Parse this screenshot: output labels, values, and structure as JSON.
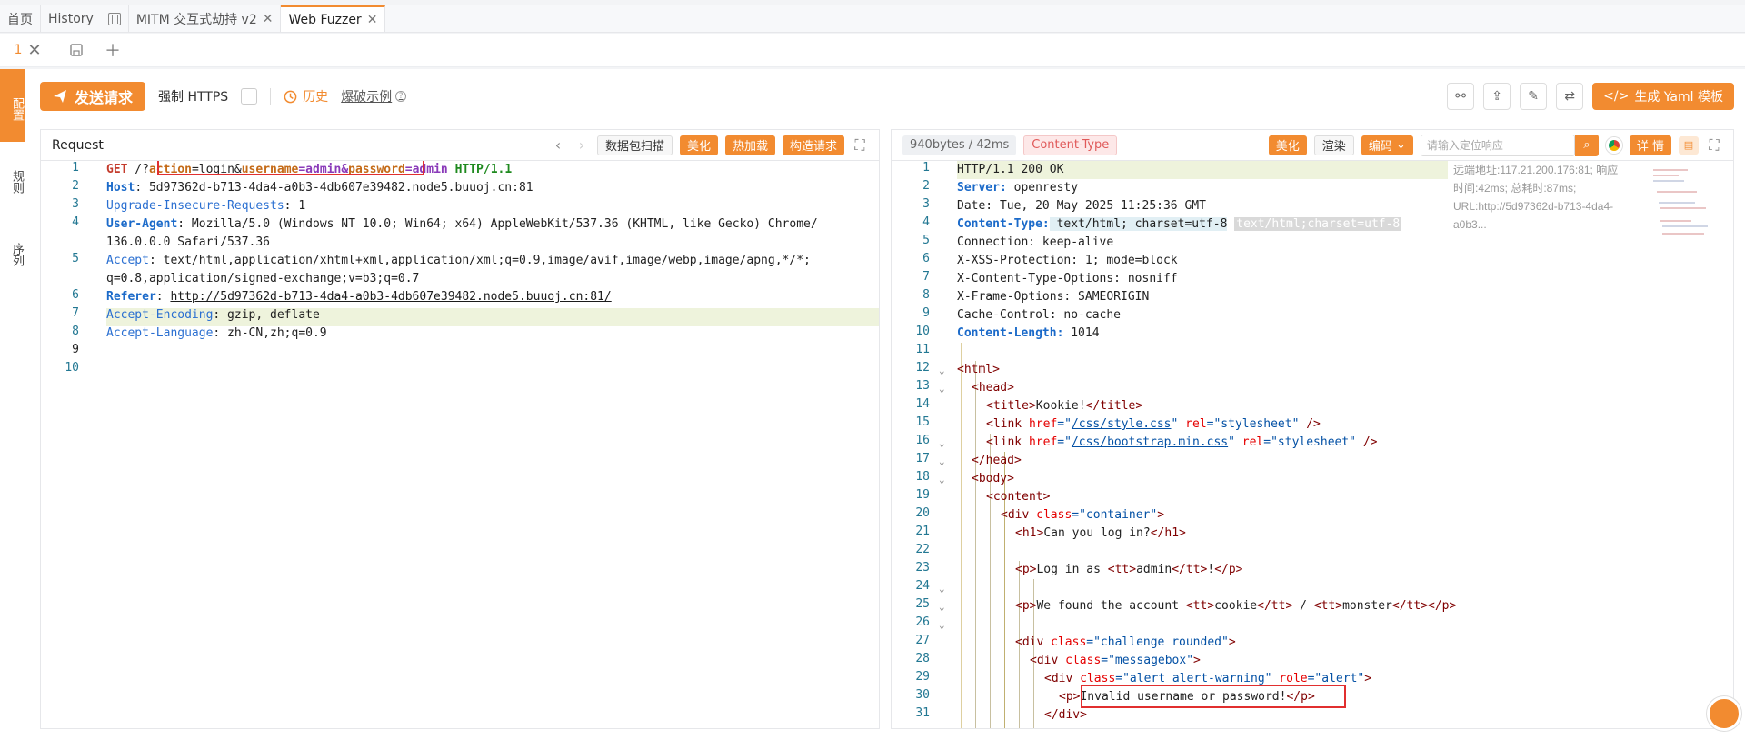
{
  "tabs": [
    {
      "label": "首页"
    },
    {
      "label": "History"
    },
    {
      "label": "MITM 交互式劫持 v2"
    },
    {
      "label": "Web Fuzzer"
    }
  ],
  "subbar": {
    "page_num": "1"
  },
  "leftstrip": [
    {
      "label": "配置"
    },
    {
      "label": "规则"
    },
    {
      "label": "序列"
    }
  ],
  "actions": {
    "send": "发送请求",
    "force_https": "强制 HTTPS",
    "history": "历史",
    "brute": "爆破示例",
    "yaml": "生成 Yaml 模板"
  },
  "request": {
    "title": "Request",
    "btn_scan": "数据包扫描",
    "btn_beautify": "美化",
    "btn_hotload": "热加载",
    "btn_build": "构造请求",
    "line_numbers": [
      "1",
      "2",
      "3",
      "4",
      "",
      "5",
      "",
      "6",
      "7",
      "8",
      "9",
      "10"
    ]
  },
  "response": {
    "size": "940bytes / 42ms",
    "ctype": "Content-Type",
    "btn_beautify": "美化",
    "btn_render": "渲染",
    "btn_encode": "编码",
    "search_placeholder": "请输入定位响应",
    "btn_detail": "详 情",
    "info": "远端地址:117.21.200.176:81; 响应时间:42ms; 总耗时:87ms; URL:http://5d97362d-b713-4da4-a0b3...",
    "line_numbers": [
      "1",
      "2",
      "3",
      "4",
      "5",
      "6",
      "7",
      "8",
      "9",
      "10",
      "11",
      "12",
      "13",
      "14",
      "15",
      "16",
      "17",
      "18",
      "19",
      "20",
      "21",
      "22",
      "23",
      "24",
      "25",
      "26",
      "27",
      "28",
      "29",
      "30",
      "31"
    ]
  },
  "req_lines": {
    "l1a": "GET",
    "l1b": " /?",
    "l1c": "action",
    "l1d": "=login&",
    "l1e": "username",
    "l1f": "=admin&",
    "l1g": "password",
    "l1h": "=admin",
    "l1i": " HTTP/1.1",
    "l2a": "Host",
    "l2b": ": 5d97362d-b713-4da4-a0b3-4db607e39482.node5.buuoj.cn:81",
    "l3a": "Upgrade-Insecure-Requests",
    "l3b": ": 1",
    "l4a": "User-Agent",
    "l4b": ": Mozilla/5.0 (Windows NT 10.0; Win64; x64) AppleWebKit/537.36 (KHTML, like Gecko) Chrome/",
    "l4c": "136.0.0.0 Safari/537.36",
    "l5a": "Accept",
    "l5b": ": text/html,application/xhtml+xml,application/xml;q=0.9,image/avif,image/webp,image/apng,*/*;",
    "l5c": "q=0.8,application/signed-exchange;v=b3;q=0.7",
    "l6a": "Referer",
    "l6b": ": ",
    "l6c": "http://5d97362d-b713-4da4-a0b3-4db607e39482.node5.buuoj.cn:81/",
    "l7a": "Accept-Encoding",
    "l7b": ": gzip, deflate",
    "l8a": "Accept-Language",
    "l8b": ": zh-CN,zh;q=0.9"
  },
  "resp_lines": {
    "r1": "HTTP/1.1 200 OK",
    "r2a": "Server:",
    "r2b": " openresty",
    "r3": "Date: Tue, 20 May 2025 11:25:36 GMT",
    "r4a": "Content-Type:",
    "r4b": " text/html; charset=utf-8",
    "r4c": "text/html;charset=utf-8",
    "r5": "Connection: keep-alive",
    "r6": "X-XSS-Protection: 1; mode=block",
    "r7": "X-Content-Type-Options: nosniff",
    "r8": "X-Frame-Options: SAMEORIGIN",
    "r9": "Cache-Control: no-cache",
    "r10a": "Content-Length:",
    "r10b": " 1014",
    "r12": "<html>",
    "r13": "<head>",
    "r14a": "<title>",
    "r14b": "Kookie!",
    "r14c": "</title>",
    "r15a": "<link ",
    "r15b": "href",
    "r15c": "=\"",
    "r15d": "/css/style.css",
    "r15e": "\" ",
    "r15f": "rel",
    "r15g": "=\"stylesheet\"",
    "r15h": " />",
    "r16d": "/css/bootstrap.min.css",
    "r17": "</head>",
    "r18": "<body>",
    "r19": "<content>",
    "r20a": "<div ",
    "r20b": "class",
    "r20c": "=\"container\"",
    "r20d": ">",
    "r21a": "<h1>",
    "r21b": "Can you log in?",
    "r21c": "</h1>",
    "r23a": "<p>",
    "r23b": "Log in as ",
    "r23c": "<tt>",
    "r23d": "admin",
    "r23e": "</tt>",
    "r23f": "!",
    "r23g": "</p>",
    "r25b": "We found the account ",
    "r25d": "cookie",
    "r25f": " / ",
    "r25h": "monster",
    "r27c": "=\"challenge rounded\"",
    "r28c": "=\"messagebox\"",
    "r29c": "=\"alert alert-warning\"",
    "r29f": "role",
    "r29g": "=\"alert\"",
    "r30b": "Invalid username or password!",
    "r31": "</div>"
  }
}
